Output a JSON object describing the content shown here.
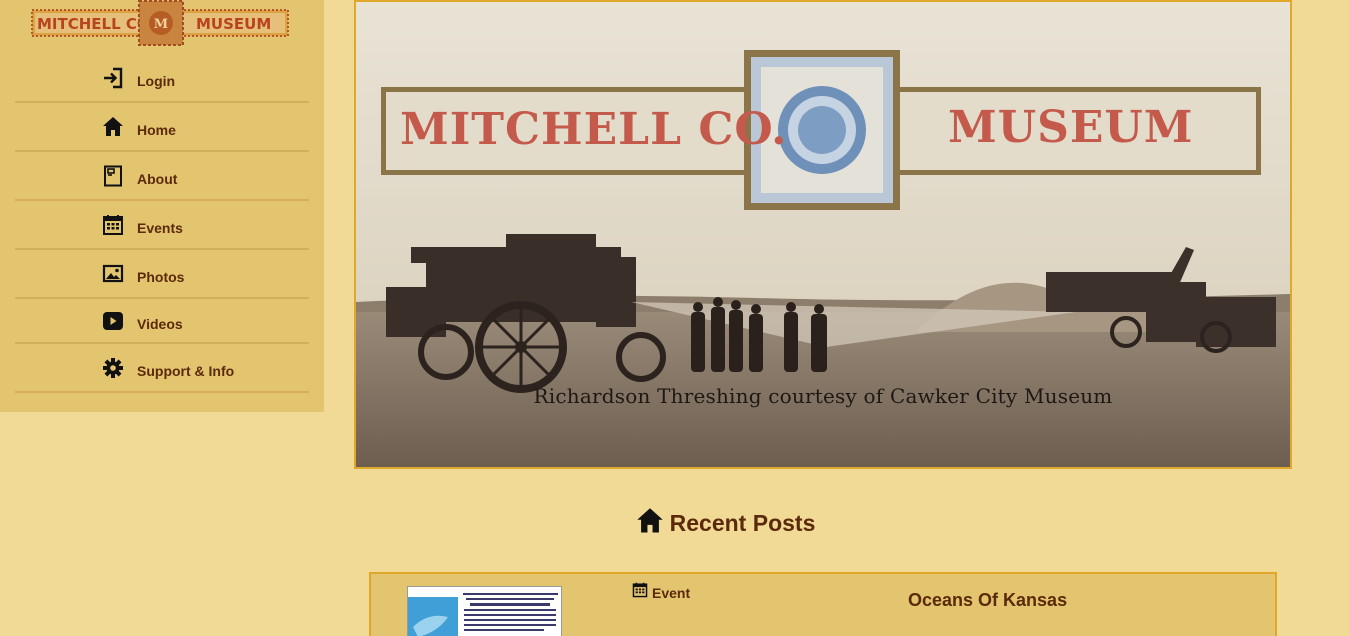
{
  "logo": {
    "left": "MITCHELL CO.",
    "right": "MUSEUM",
    "monogram": "M"
  },
  "nav": [
    {
      "label": "Login",
      "icon": "login-icon"
    },
    {
      "label": "Home",
      "icon": "home-icon"
    },
    {
      "label": "About",
      "icon": "book-icon"
    },
    {
      "label": "Events",
      "icon": "calendar-icon"
    },
    {
      "label": "Photos",
      "icon": "image-icon"
    },
    {
      "label": "Videos",
      "icon": "video-play-icon"
    },
    {
      "label": "Support & Info",
      "icon": "gear-icon"
    }
  ],
  "hero": {
    "banner_left": "MITCHELL CO.",
    "banner_right": "MUSEUM",
    "caption": "Richardson Threshing courtesy of Cawker City Museum"
  },
  "recent": {
    "title": "Recent Posts",
    "posts": [
      {
        "tag": "Event",
        "title": "Oceans Of Kansas"
      }
    ]
  },
  "colors": {
    "page_bg": "#f1d996",
    "sidebar_bg": "#e3c46f",
    "text_brown": "#5b2a0a",
    "border_gold": "#e0a82a",
    "banner_red": "#c45a4c"
  }
}
